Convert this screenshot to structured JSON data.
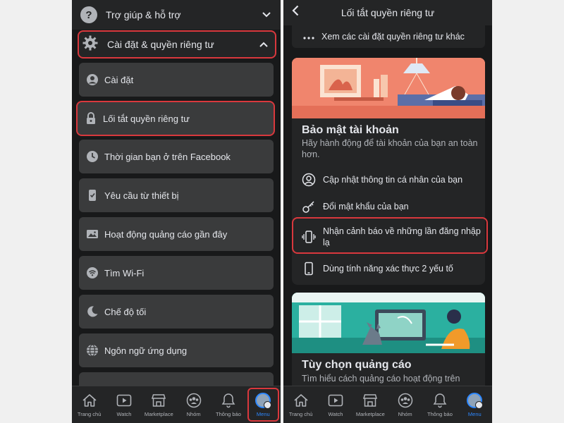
{
  "left": {
    "help": {
      "label": "Trợ giúp & hỗ trợ"
    },
    "settings_privacy": {
      "label": "Cài đặt & quyền riêng tư"
    },
    "menu_items": [
      {
        "label": "Cài đặt",
        "icon": "person-circle-icon"
      },
      {
        "label": "Lối tắt quyền riêng tư",
        "icon": "lock-icon"
      },
      {
        "label": "Thời gian bạn ở trên Facebook",
        "icon": "clock-icon"
      },
      {
        "label": "Yêu cầu từ thiết bị",
        "icon": "phone-check-icon"
      },
      {
        "label": "Hoạt động quảng cáo gần đây",
        "icon": "ad-image-icon"
      },
      {
        "label": "Tìm Wi-Fi",
        "icon": "wifi-icon"
      },
      {
        "label": "Chế độ tối",
        "icon": "moon-icon"
      },
      {
        "label": "Ngôn ngữ ứng dụng",
        "icon": "globe-icon"
      }
    ]
  },
  "nav": [
    {
      "label": "Trang chủ",
      "icon": "home-icon"
    },
    {
      "label": "Watch",
      "icon": "watch-icon"
    },
    {
      "label": "Marketplace",
      "icon": "marketplace-icon"
    },
    {
      "label": "Nhóm",
      "icon": "groups-icon"
    },
    {
      "label": "Thông báo",
      "icon": "bell-icon"
    },
    {
      "label": "Menu",
      "icon": "avatar-icon"
    }
  ],
  "right": {
    "header": {
      "title": "Lối tắt quyền riêng tư"
    },
    "more": {
      "label": "Xem các cài đặt quyền riêng tư khác"
    },
    "security": {
      "title": "Bảo mật tài khoản",
      "description": "Hãy hành động để tài khoản của bạn an toàn hơn.",
      "items": [
        {
          "label": "Cập nhật thông tin cá nhân của bạn",
          "icon": "person-circle-icon"
        },
        {
          "label": "Đổi mật khẩu của bạn",
          "icon": "key-icon"
        },
        {
          "label": "Nhận cảnh báo về những lần đăng nhập lạ",
          "icon": "phone-vibrate-icon"
        },
        {
          "label": "Dùng tính năng xác thực 2 yếu tố",
          "icon": "phone-icon"
        }
      ]
    },
    "ads": {
      "title": "Tùy chọn quảng cáo",
      "description": "Tìm hiểu cách quảng cáo hoạt động trên"
    }
  },
  "colors": {
    "background": "#18191a",
    "card": "#242526",
    "menu_card": "#3a3b3c",
    "highlight": "#d9383d",
    "accent": "#2d88ff",
    "security_banner": "#f0856d",
    "ads_banner": "#2bb0a0"
  }
}
